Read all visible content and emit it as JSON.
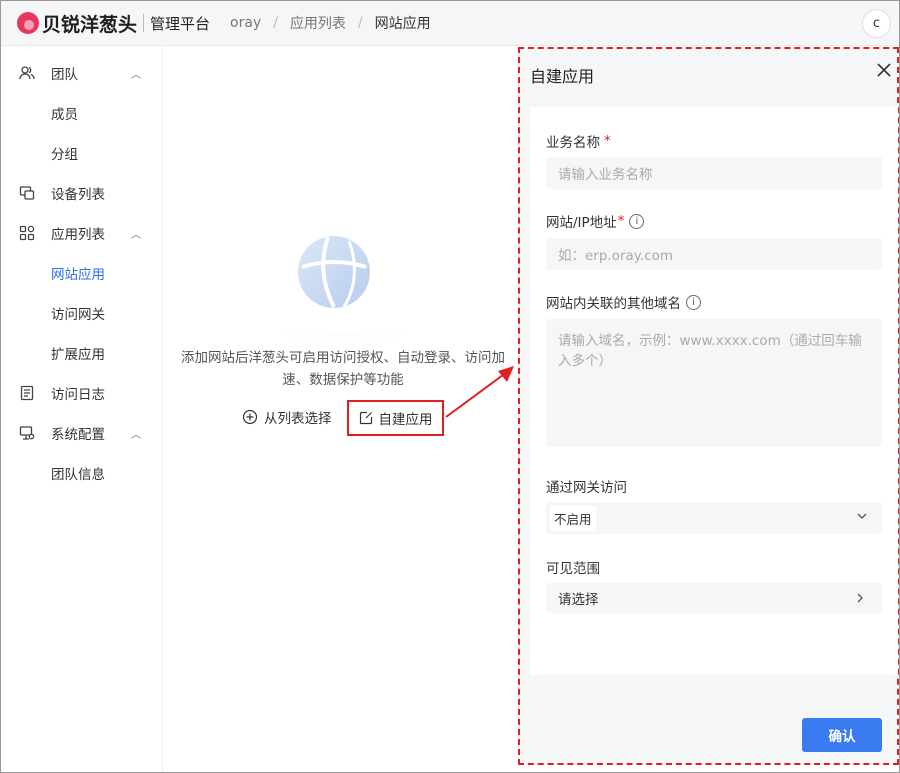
{
  "header": {
    "brand": "贝锐洋葱头",
    "platform": "管理平台",
    "breadcrumb": [
      "oray",
      "应用列表",
      "网站应用"
    ],
    "avatar_letter": "c"
  },
  "sidebar": {
    "items": [
      {
        "label": "团队",
        "icon": "team-icon",
        "expanded": true
      },
      {
        "label": "成员"
      },
      {
        "label": "分组"
      },
      {
        "label": "设备列表",
        "icon": "device-icon"
      },
      {
        "label": "应用列表",
        "icon": "apps-icon",
        "expanded": true
      },
      {
        "label": "网站应用",
        "active": true
      },
      {
        "label": "访问网关"
      },
      {
        "label": "扩展应用"
      },
      {
        "label": "访问日志",
        "icon": "log-icon"
      },
      {
        "label": "系统配置",
        "icon": "settings-icon",
        "expanded": true
      },
      {
        "label": "团队信息"
      }
    ]
  },
  "content": {
    "empty_text": "添加网站后洋葱头可启用访问授权、自动登录、访问加速、数据保护等功能",
    "select_from_list": "从列表选择",
    "create_app": "自建应用"
  },
  "drawer": {
    "title": "自建应用",
    "fields": {
      "name_label": "业务名称",
      "name_required": "*",
      "name_placeholder": "请输入业务名称",
      "site_label": "网站/IP地址",
      "site_required": "*",
      "site_placeholder": "如：erp.oray.com",
      "domains_label": "网站内关联的其他域名",
      "domains_placeholder": "请输入域名，示例：www.xxxx.com（通过回车输入多个）",
      "gateway_label": "通过网关访问",
      "gateway_value": "不启用",
      "scope_label": "可见范围",
      "scope_value": "请选择"
    },
    "confirm": "确认"
  },
  "colors": {
    "accent": "#3a7bf0",
    "active_nav": "#2f6fe4",
    "highlight": "#e02020",
    "brand": "#e8365d"
  }
}
